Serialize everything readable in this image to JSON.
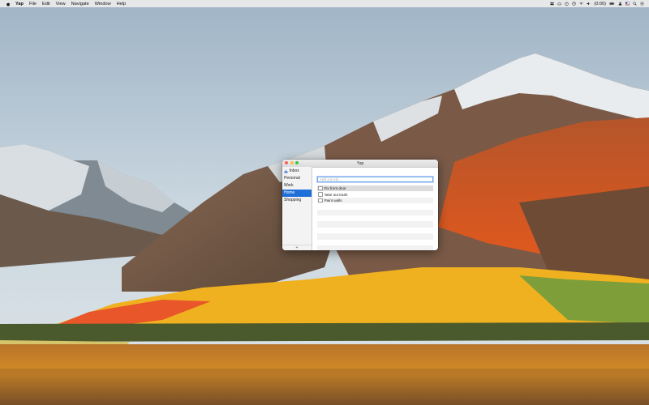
{
  "menubar": {
    "app_name": "Yap",
    "menus": [
      "File",
      "Edit",
      "View",
      "Navigate",
      "Window",
      "Help"
    ],
    "status_icons": [
      "dropbox-icon",
      "cloud-icon",
      "timer-icon",
      "clock-icon",
      "wifi-icon",
      "volume-icon"
    ],
    "battery_text": "(0:00)",
    "right_icons": [
      "battery-icon",
      "user-icon",
      "flag-icon",
      "spotlight-icon",
      "notification-center-icon"
    ]
  },
  "window": {
    "title": "Yap",
    "sidebar": {
      "items": [
        {
          "label": "Inbox",
          "icon": "inbox-icon",
          "selected": false
        },
        {
          "label": "Personal",
          "selected": false
        },
        {
          "label": "Work",
          "selected": false
        },
        {
          "label": "Home",
          "selected": true
        },
        {
          "label": "Shopping",
          "selected": false
        }
      ],
      "add_label": "+"
    },
    "input": {
      "value": "",
      "placeholder": "Add a to-do..."
    },
    "todos": [
      {
        "label": "Fix front door",
        "checked": false,
        "selected": true
      },
      {
        "label": "Take out trash",
        "checked": false,
        "selected": false
      },
      {
        "label": "Paint walls",
        "checked": false,
        "selected": false
      }
    ]
  },
  "colors": {
    "selection": "#1f6fd9",
    "menubar": "#ececec"
  }
}
